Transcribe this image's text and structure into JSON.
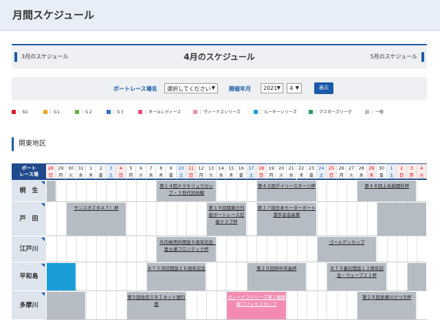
{
  "page": {
    "title": "月間スケジュール"
  },
  "month_nav": {
    "prev": "3月のスケジュール",
    "current": "4月のスケジュール",
    "next": "5月のスケジュール"
  },
  "filter": {
    "venue_label": "ボートレース場名",
    "venue_value": "選択してください",
    "period_label": "開催年月",
    "year_value": "2021",
    "month_value": "4",
    "show_button": "表示"
  },
  "legend": [
    {
      "label": "：SG",
      "color": "#e31b23"
    },
    {
      "label": "：G１",
      "color": "#f0a81c"
    },
    {
      "label": "：G２",
      "color": "#6cb33f"
    },
    {
      "label": "：G３",
      "color": "#2f6fc0"
    },
    {
      "label": "：オールレディース",
      "color": "#e84b80"
    },
    {
      "label": "：ヴィーナスシリーズ",
      "color": "#f48cb1"
    },
    {
      "label": "：ルーキーシリーズ",
      "color": "#1a9ed8"
    },
    {
      "label": "：マスターズリーグ",
      "color": "#2e9b5e"
    },
    {
      "label": "：一般",
      "color": "#b6bcc4"
    }
  ],
  "region": "関東地区",
  "schedule": {
    "corner_label": "ボート\nレース場",
    "days": [
      {
        "d": "28",
        "w": "日",
        "t": "sun"
      },
      {
        "d": "29",
        "w": "月",
        "t": ""
      },
      {
        "d": "30",
        "w": "火",
        "t": ""
      },
      {
        "d": "31",
        "w": "水",
        "t": ""
      },
      {
        "d": "1",
        "w": "木",
        "t": ""
      },
      {
        "d": "2",
        "w": "金",
        "t": ""
      },
      {
        "d": "3",
        "w": "土",
        "t": "sat"
      },
      {
        "d": "4",
        "w": "日",
        "t": "sun"
      },
      {
        "d": "5",
        "w": "月",
        "t": ""
      },
      {
        "d": "6",
        "w": "火",
        "t": ""
      },
      {
        "d": "7",
        "w": "水",
        "t": ""
      },
      {
        "d": "8",
        "w": "木",
        "t": ""
      },
      {
        "d": "9",
        "w": "金",
        "t": ""
      },
      {
        "d": "10",
        "w": "土",
        "t": "sat"
      },
      {
        "d": "11",
        "w": "日",
        "t": "sun"
      },
      {
        "d": "12",
        "w": "月",
        "t": ""
      },
      {
        "d": "13",
        "w": "火",
        "t": ""
      },
      {
        "d": "14",
        "w": "水",
        "t": ""
      },
      {
        "d": "15",
        "w": "木",
        "t": ""
      },
      {
        "d": "16",
        "w": "金",
        "t": ""
      },
      {
        "d": "17",
        "w": "土",
        "t": "sat"
      },
      {
        "d": "18",
        "w": "日",
        "t": "sun"
      },
      {
        "d": "19",
        "w": "月",
        "t": ""
      },
      {
        "d": "20",
        "w": "火",
        "t": ""
      },
      {
        "d": "21",
        "w": "水",
        "t": ""
      },
      {
        "d": "22",
        "w": "木",
        "t": ""
      },
      {
        "d": "23",
        "w": "金",
        "t": ""
      },
      {
        "d": "24",
        "w": "土",
        "t": "sat"
      },
      {
        "d": "25",
        "w": "日",
        "t": "sun"
      },
      {
        "d": "26",
        "w": "月",
        "t": ""
      },
      {
        "d": "27",
        "w": "火",
        "t": ""
      },
      {
        "d": "28",
        "w": "水",
        "t": ""
      },
      {
        "d": "29",
        "w": "木",
        "t": "sun"
      },
      {
        "d": "30",
        "w": "金",
        "t": ""
      },
      {
        "d": "1",
        "w": "土",
        "t": "sat"
      },
      {
        "d": "2",
        "w": "日",
        "t": "sun"
      },
      {
        "d": "3",
        "w": "月",
        "t": "sun"
      },
      {
        "d": "4",
        "w": "火",
        "t": "sun"
      }
    ],
    "venues": [
      {
        "name": "桐　生",
        "races": [
          {
            "start": 0,
            "len": 1,
            "title": "",
            "type": "general"
          },
          {
            "start": 11,
            "len": 6,
            "title": "第１４回ドラキリュウカップ・３世代対抗戦",
            "type": "general"
          },
          {
            "start": 21,
            "len": 6,
            "title": "第４３回デイリースポーツ杯",
            "type": "general"
          },
          {
            "start": 31,
            "len": 6,
            "title": "第４８回上毛新聞社杯",
            "type": "general"
          }
        ]
      },
      {
        "name": "戸　田",
        "races": [
          {
            "start": 2,
            "len": 6,
            "title": "サンスポＺＢＡＴ！杯",
            "type": "general"
          },
          {
            "start": 16,
            "len": 4,
            "title": "第３９回関東日刊紙ボートレース記者クラブ杯",
            "type": "general"
          },
          {
            "start": 21,
            "len": 6,
            "title": "第３７回日本モーターボート選手会会長賞",
            "type": "general"
          },
          {
            "start": 33,
            "len": 5,
            "title": "",
            "type": "general"
          }
        ]
      },
      {
        "name": "江戸川",
        "races": [
          {
            "start": 11,
            "len": 6,
            "title": "外向発売所開設９周年記念　富士通フロンテック杯",
            "type": "general"
          },
          {
            "start": 27,
            "len": 6,
            "title": "ゴールデンカップ",
            "type": "general"
          }
        ]
      },
      {
        "name": "平和島",
        "races": [
          {
            "start": 0,
            "len": 3,
            "title": "",
            "type": "rookie"
          },
          {
            "start": 10,
            "len": 6,
            "title": "ＢＴＳ河辺開設２６周年記念",
            "type": "general"
          },
          {
            "start": 20,
            "len": 6,
            "title": "第２０回府中市長杯",
            "type": "general"
          },
          {
            "start": 28,
            "len": 6,
            "title": "ＢＴＳ裏石開設１２周年記念・ウェーブ２１杯",
            "type": "general"
          },
          {
            "start": 36,
            "len": 2,
            "title": "",
            "type": "general"
          }
        ]
      },
      {
        "name": "多摩川",
        "races": [
          {
            "start": 0,
            "len": 4,
            "title": "",
            "type": "general"
          },
          {
            "start": 8,
            "len": 6,
            "title": "第５回住信ＳＢＩネット銀行賞",
            "type": "general"
          },
          {
            "start": 18,
            "len": 6,
            "title": "ヴィーナスシリーズ第２戦競艇プリンセスカップ",
            "type": "lady"
          },
          {
            "start": 31,
            "len": 6,
            "title": "第２８回多摩川さつき杯",
            "type": "general"
          }
        ]
      }
    ]
  }
}
